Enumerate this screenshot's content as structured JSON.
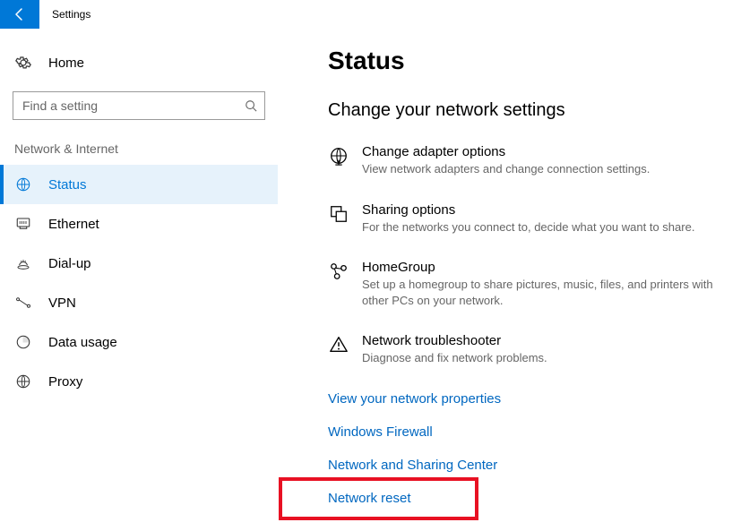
{
  "app": {
    "title": "Settings"
  },
  "sidebar": {
    "home_label": "Home",
    "search_placeholder": "Find a setting",
    "section_label": "Network & Internet",
    "items": [
      {
        "label": "Status"
      },
      {
        "label": "Ethernet"
      },
      {
        "label": "Dial-up"
      },
      {
        "label": "VPN"
      },
      {
        "label": "Data usage"
      },
      {
        "label": "Proxy"
      }
    ]
  },
  "main": {
    "title": "Status",
    "subheading": "Change your network settings",
    "options": [
      {
        "title": "Change adapter options",
        "desc": "View network adapters and change connection settings."
      },
      {
        "title": "Sharing options",
        "desc": "For the networks you connect to, decide what you want to share."
      },
      {
        "title": "HomeGroup",
        "desc": "Set up a homegroup to share pictures, music, files, and printers with other PCs on your network."
      },
      {
        "title": "Network troubleshooter",
        "desc": "Diagnose and fix network problems."
      }
    ],
    "links": [
      "View your network properties",
      "Windows Firewall",
      "Network and Sharing Center",
      "Network reset"
    ]
  }
}
